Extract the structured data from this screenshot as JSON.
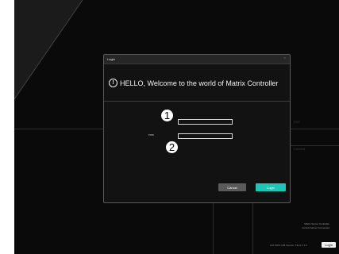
{
  "background": {
    "labels": {
      "right_upper": "DSP",
      "right_lower": "Camera"
    },
    "brand": {
      "line1": "Matrix Server Controller",
      "line2": "Control Server Connected"
    },
    "version": "192.168.0.199 Version: Client 2.1.0",
    "login_button": "Login"
  },
  "dialog": {
    "title": "Login",
    "close": "×",
    "welcome": "HELLO, Welcome to the world of Matrix Controller",
    "fields": {
      "username": {
        "value": "",
        "placeholder": ""
      },
      "password": {
        "label": "PWD",
        "value": "",
        "placeholder": ""
      }
    },
    "markers": [
      "1",
      "2"
    ],
    "cancel_label": "Cancel",
    "login_label": "Login"
  },
  "colors": {
    "accent": "#1ec6b8",
    "cancel": "#5a5a5a",
    "background": "#0a0a0a"
  }
}
